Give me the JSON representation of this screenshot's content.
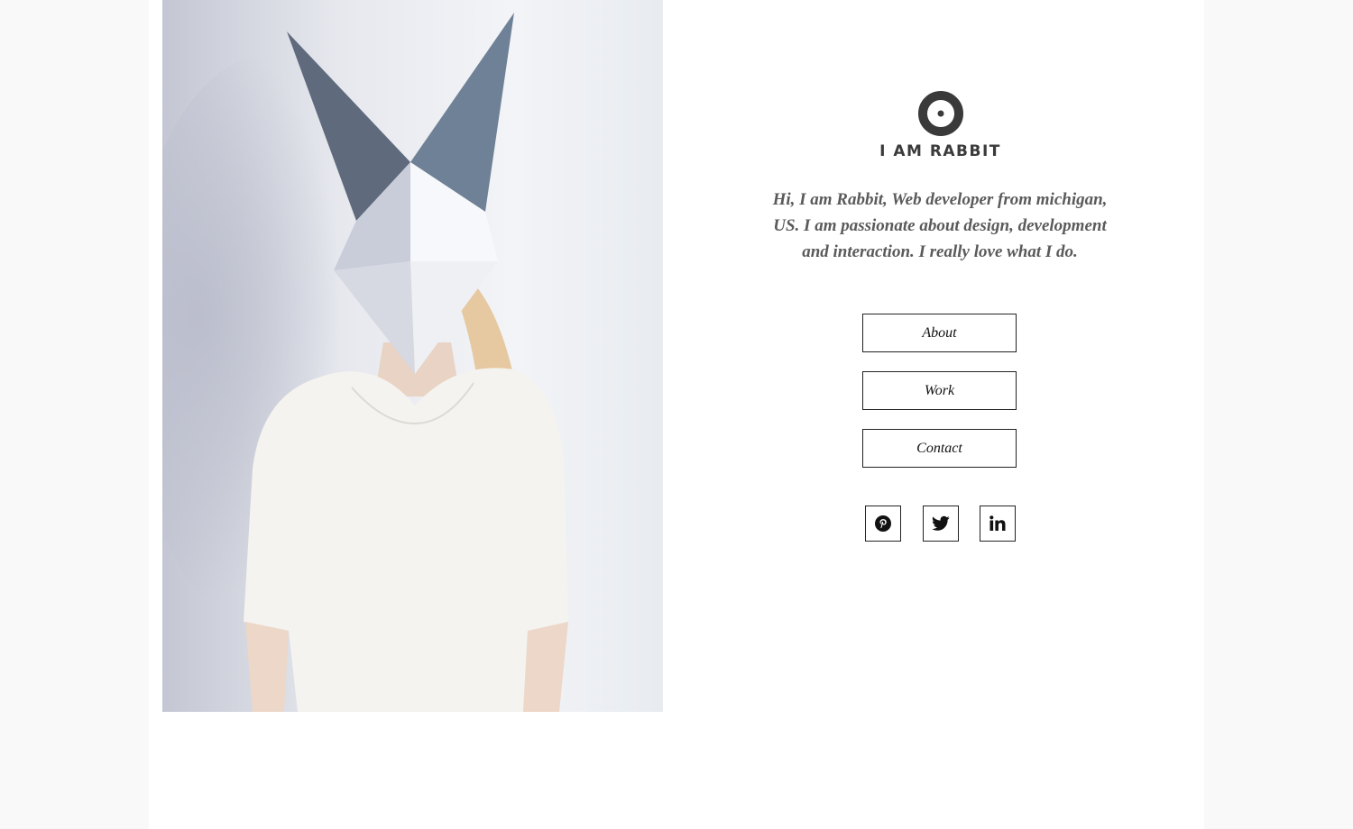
{
  "brand": {
    "name": "I AM RABBIT",
    "logo_icon": "target-circle-icon",
    "logo_color": "#3a3a3a"
  },
  "hero_image": {
    "icon": "origami-rabbit-mask-portrait"
  },
  "intro": {
    "text": "Hi, I am Rabbit, Web developer from michigan, US. I am passionate about design, development and interaction. I really love what I do."
  },
  "nav": {
    "items": [
      {
        "label": "About"
      },
      {
        "label": "Work"
      },
      {
        "label": "Contact"
      }
    ]
  },
  "social": {
    "items": [
      {
        "icon": "pinterest-icon"
      },
      {
        "icon": "twitter-icon"
      },
      {
        "icon": "linkedin-icon"
      }
    ]
  },
  "colors": {
    "text": "#5a5a5a",
    "border": "#222222",
    "page_bg": "#ffffff",
    "outer_bg": "#f9f9f9"
  }
}
